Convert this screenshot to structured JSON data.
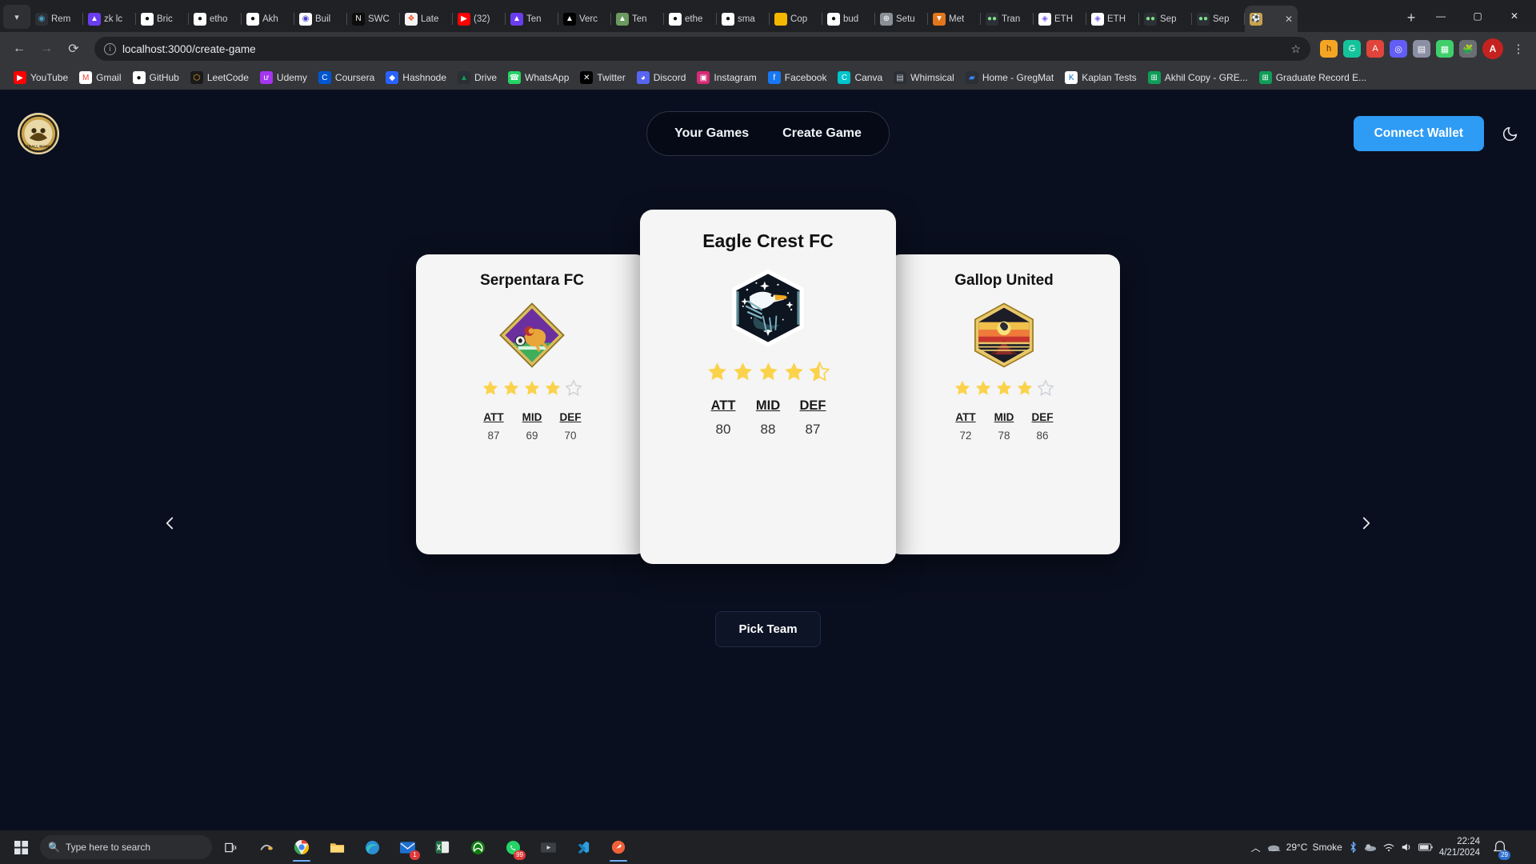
{
  "browser": {
    "tabstrip_menu_icon": "chevron-down-icon",
    "new_tab_label": "+",
    "window_controls": {
      "minimize": "—",
      "maximize": "▢",
      "close": "✕"
    },
    "tabs": [
      {
        "label": "Rem",
        "icon": "remix-icon",
        "active": false
      },
      {
        "label": "zk lc",
        "icon": "vercel-triangle-icon",
        "active": false
      },
      {
        "label": "Bric",
        "icon": "github-icon",
        "active": false
      },
      {
        "label": "etho",
        "icon": "github-icon",
        "active": false
      },
      {
        "label": "Akh",
        "icon": "github-icon",
        "active": false
      },
      {
        "label": "Buil",
        "icon": "buildspace-icon",
        "active": false
      },
      {
        "label": "SWC",
        "icon": "notion-n-icon",
        "active": false
      },
      {
        "label": "Late",
        "icon": "microsoft-icon",
        "active": false
      },
      {
        "label": "(32)",
        "icon": "youtube-icon",
        "active": false
      },
      {
        "label": "Ten",
        "icon": "vercel-triangle-icon",
        "active": false
      },
      {
        "label": "Verc",
        "icon": "vercel-black-icon",
        "active": false
      },
      {
        "label": "Ten",
        "icon": "tenderly-icon",
        "active": false
      },
      {
        "label": "ethe",
        "icon": "github-icon",
        "active": false
      },
      {
        "label": "sma",
        "icon": "github-icon",
        "active": false
      },
      {
        "label": "Cop",
        "icon": "yellow-square-icon",
        "active": false
      },
      {
        "label": "bud",
        "icon": "github-icon",
        "active": false
      },
      {
        "label": "Setu",
        "icon": "globe-icon",
        "active": false
      },
      {
        "label": "Met",
        "icon": "metamask-fox-icon",
        "active": false
      },
      {
        "label": "Tran",
        "icon": "etherscan-eyes-icon",
        "active": false
      },
      {
        "label": "ETH",
        "icon": "ethereum-rainbow-icon",
        "active": false
      },
      {
        "label": "ETH",
        "icon": "ethereum-rainbow-icon",
        "active": false
      },
      {
        "label": "Sep",
        "icon": "etherscan-eyes-icon",
        "active": false
      },
      {
        "label": "Sep",
        "icon": "etherscan-eyes-icon",
        "active": false
      },
      {
        "label": "",
        "icon": "football-manager-icon",
        "active": true
      }
    ],
    "toolbar": {
      "back_icon": "back-arrow-icon",
      "forward_icon": "forward-arrow-icon",
      "reload_icon": "reload-icon",
      "site_info_icon": "info-circle-icon",
      "url": "localhost:3000/create-game",
      "bookmark_star_icon": "star-outline-icon",
      "extensions": [
        "honey-extension-icon",
        "grammarly-extension-icon",
        "adblock-extension-icon",
        "loom-extension-icon",
        "clipboard-extension-icon",
        "notes-extension-icon",
        "puzzle-extensions-icon"
      ],
      "profile_initial": "A",
      "menu_icon": "kebab-menu-icon"
    },
    "bookmarks": [
      {
        "label": "YouTube",
        "icon": "youtube-icon"
      },
      {
        "label": "Gmail",
        "icon": "gmail-icon"
      },
      {
        "label": "GitHub",
        "icon": "github-icon"
      },
      {
        "label": "LeetCode",
        "icon": "leetcode-icon"
      },
      {
        "label": "Udemy",
        "icon": "udemy-icon"
      },
      {
        "label": "Coursera",
        "icon": "coursera-icon"
      },
      {
        "label": "Hashnode",
        "icon": "hashnode-icon"
      },
      {
        "label": "Drive",
        "icon": "google-drive-icon"
      },
      {
        "label": "WhatsApp",
        "icon": "whatsapp-icon"
      },
      {
        "label": "Twitter",
        "icon": "twitter-x-icon"
      },
      {
        "label": "Discord",
        "icon": "discord-icon"
      },
      {
        "label": "Instagram",
        "icon": "instagram-icon"
      },
      {
        "label": "Facebook",
        "icon": "facebook-icon"
      },
      {
        "label": "Canva",
        "icon": "canva-icon"
      },
      {
        "label": "Whimsical",
        "icon": "whimsical-icon"
      },
      {
        "label": "Home - GregMat",
        "icon": "gregmat-icon"
      },
      {
        "label": "Kaplan Tests",
        "icon": "kaplan-icon"
      },
      {
        "label": "Akhil Copy - GRE...",
        "icon": "google-sheets-icon"
      },
      {
        "label": "Graduate Record E...",
        "icon": "google-sheets-icon"
      }
    ]
  },
  "app": {
    "logo_name": "football-manager-logo",
    "nav": [
      {
        "label": "Your Games",
        "name": "tab-your-games"
      },
      {
        "label": "Create Game",
        "name": "tab-create-game"
      }
    ],
    "connect_wallet_label": "Connect Wallet",
    "theme_toggle_icon": "moon-icon",
    "accent_color": "#2e9bf5",
    "page_background": "#0a0f1f",
    "card_background": "#f5f5f5",
    "star_color": "#fbd24b",
    "prev_arrow_icon": "chevron-left-icon",
    "next_arrow_icon": "chevron-right-icon",
    "pick_team_label": "Pick Team",
    "stat_headers": [
      "ATT",
      "MID",
      "DEF"
    ],
    "teams": [
      {
        "name": "Serpentara FC",
        "crest": "lion-diamond-crest",
        "rating": 4,
        "stats": {
          "ATT": "87",
          "MID": "69",
          "DEF": "70"
        },
        "position": "left"
      },
      {
        "name": "Eagle Crest FC",
        "crest": "eagle-hexagon-crest",
        "rating": 4.5,
        "stats": {
          "ATT": "80",
          "MID": "88",
          "DEF": "87"
        },
        "position": "center"
      },
      {
        "name": "Gallop United",
        "crest": "sunset-horse-crest",
        "rating": 4,
        "stats": {
          "ATT": "72",
          "MID": "78",
          "DEF": "86"
        },
        "position": "right"
      }
    ]
  },
  "taskbar": {
    "start_icon": "windows-start-icon",
    "search_placeholder": "Type here to search",
    "search_icon": "search-icon",
    "taskview_icon": "task-view-icon",
    "apps": [
      {
        "name": "chrome-taskbar-icon",
        "badge": ""
      },
      {
        "name": "file-explorer-taskbar-icon",
        "badge": ""
      },
      {
        "name": "edge-taskbar-icon",
        "badge": ""
      },
      {
        "name": "mail-taskbar-icon",
        "badge": "1"
      },
      {
        "name": "excel-taskbar-icon",
        "badge": ""
      },
      {
        "name": "xbox-taskbar-icon",
        "badge": ""
      },
      {
        "name": "whatsapp-taskbar-icon",
        "badge": "99"
      },
      {
        "name": "media-taskbar-icon",
        "badge": ""
      },
      {
        "name": "vscode-taskbar-icon",
        "badge": ""
      },
      {
        "name": "postman-taskbar-icon",
        "badge": ""
      }
    ],
    "tray": {
      "overflow_icon": "chevron-up-icon",
      "weather_temp": "29°C",
      "weather_desc": "Smoke",
      "weather_icon": "smoke-icon",
      "bluetooth_icon": "bluetooth-icon",
      "onedrive_icon": "onedrive-icon",
      "network_icon": "network-icon",
      "volume_icon": "volume-icon",
      "battery_icon": "battery-icon",
      "time": "22:24",
      "date": "4/21/2024",
      "notification_count": "29",
      "notification_icon": "notification-icon"
    }
  }
}
